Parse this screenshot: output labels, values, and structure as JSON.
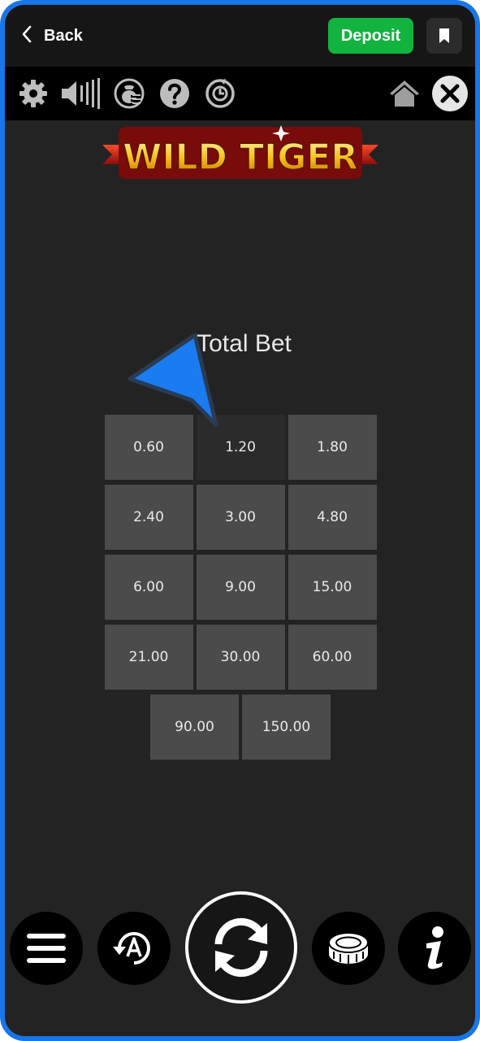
{
  "appbar": {
    "back_label": "Back",
    "deposit_label": "Deposit"
  },
  "toolbar": {
    "icons": [
      "gear-icon",
      "sound-icon",
      "paytable-icon",
      "help-icon",
      "history-icon",
      "home-icon",
      "close-icon"
    ]
  },
  "game": {
    "logo_text": "WILD TIGER"
  },
  "bet_panel": {
    "title": "Total Bet",
    "selected_value": "1.20",
    "rows": [
      [
        "0.60",
        "1.20",
        "1.80"
      ],
      [
        "2.40",
        "3.00",
        "4.80"
      ],
      [
        "6.00",
        "9.00",
        "15.00"
      ],
      [
        "21.00",
        "30.00",
        "60.00"
      ],
      [
        "90.00",
        "150.00"
      ]
    ]
  },
  "controls": {
    "icons": [
      "menu-icon",
      "autoplay-icon",
      "spin-icon",
      "coin-icon",
      "info-icon"
    ]
  },
  "colors": {
    "accent_frame": "#1976e8",
    "deposit": "#12b33f",
    "background": "#232323",
    "cell": "#4b4b4b"
  }
}
